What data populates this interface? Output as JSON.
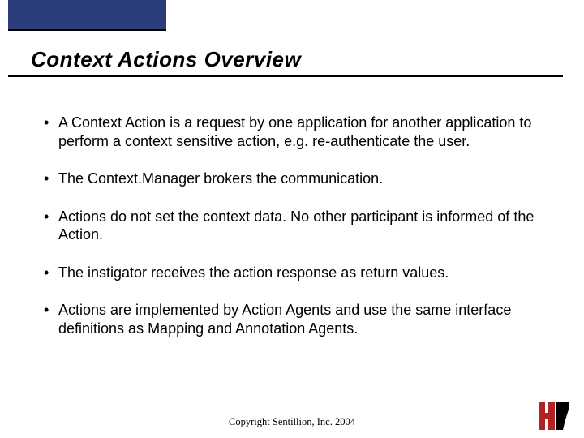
{
  "title": "Context Actions Overview",
  "bullets": [
    "A Context Action is a request by one application for another application to perform a context sensitive action, e.g. re-authenticate the user.",
    "The Context.Manager brokers the communication.",
    "Actions do not set the context data. No other participant is informed of the Action.",
    "The instigator receives the action response as return values.",
    "Actions are implemented by Action Agents and use the same interface definitions as Mapping and Annotation Agents."
  ],
  "footer": "Copyright Sentillion, Inc. 2004",
  "colors": {
    "header_bar": "#2c3e7a",
    "logo_red": "#b22222"
  }
}
